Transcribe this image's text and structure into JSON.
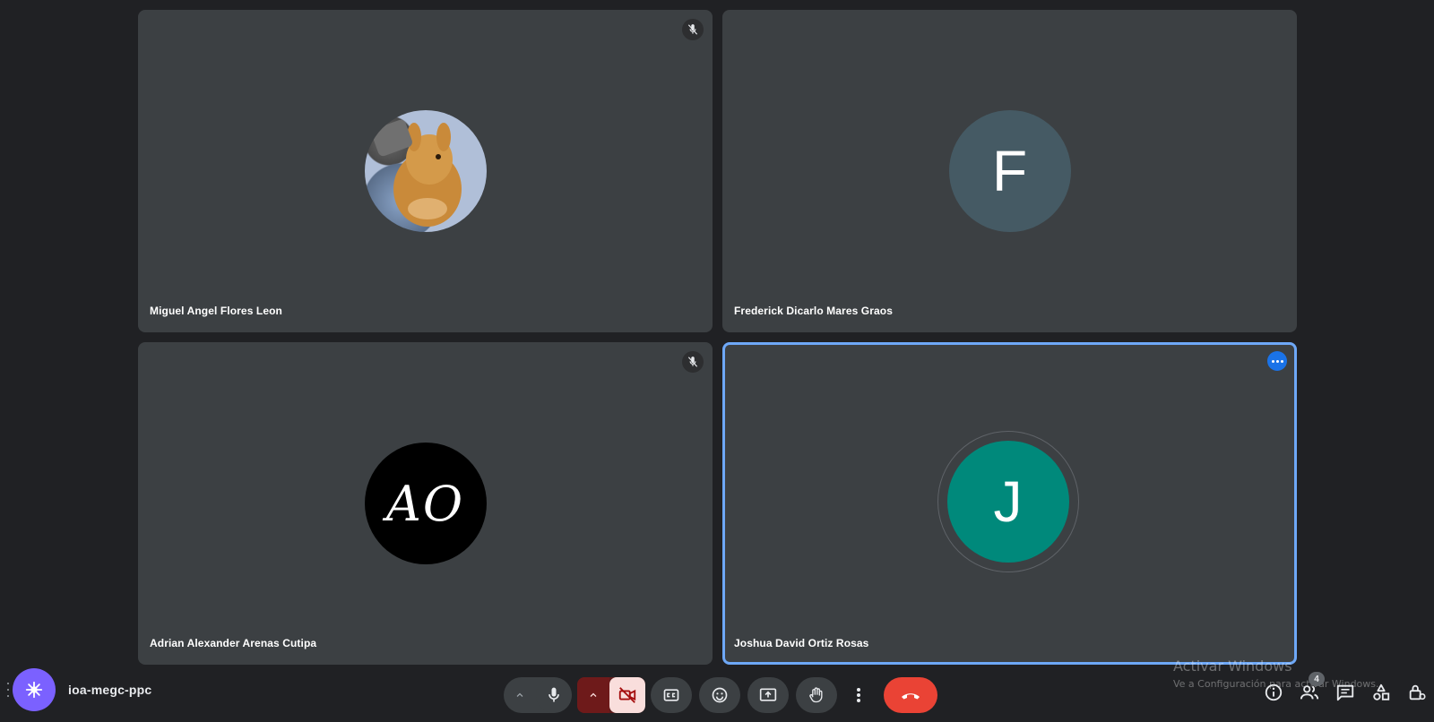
{
  "participants": [
    {
      "name": "Miguel Angel Flores Leon",
      "avatar_type": "photo",
      "muted": true
    },
    {
      "name": "Frederick Dicarlo Mares Graos",
      "avatar_type": "letter",
      "initial": "F",
      "avatar_color": "#455a64",
      "muted": false
    },
    {
      "name": "Adrian Alexander Arenas Cutipa",
      "avatar_type": "image",
      "image_text": "AO",
      "muted": true
    },
    {
      "name": "Joshua David Ortiz Rosas",
      "avatar_type": "letter",
      "initial": "J",
      "avatar_color": "#00897b",
      "speaking": true
    }
  ],
  "meeting": {
    "code": "ioa-megc-ppc",
    "activity_icon": "activities-icon"
  },
  "controls": {
    "mic": "microphone-icon",
    "camera": "camera-off-icon",
    "captions": "captions-icon",
    "reactions": "emoji-icon",
    "present": "present-screen-icon",
    "raise_hand": "hand-icon",
    "more": "more-vert-icon",
    "leave": "call-end-icon"
  },
  "right_panel": {
    "participants_count": "4",
    "icons": [
      "info-icon",
      "people-icon",
      "chat-icon",
      "activities-icon",
      "host-controls-icon"
    ]
  },
  "watermark": {
    "title": "Activar Windows",
    "subtitle": "Ve a Configuración para activar Windows."
  },
  "colors": {
    "background": "#202124",
    "tile": "#3c4043",
    "accent_blue": "#1a73e8",
    "end_call": "#ea4335"
  }
}
